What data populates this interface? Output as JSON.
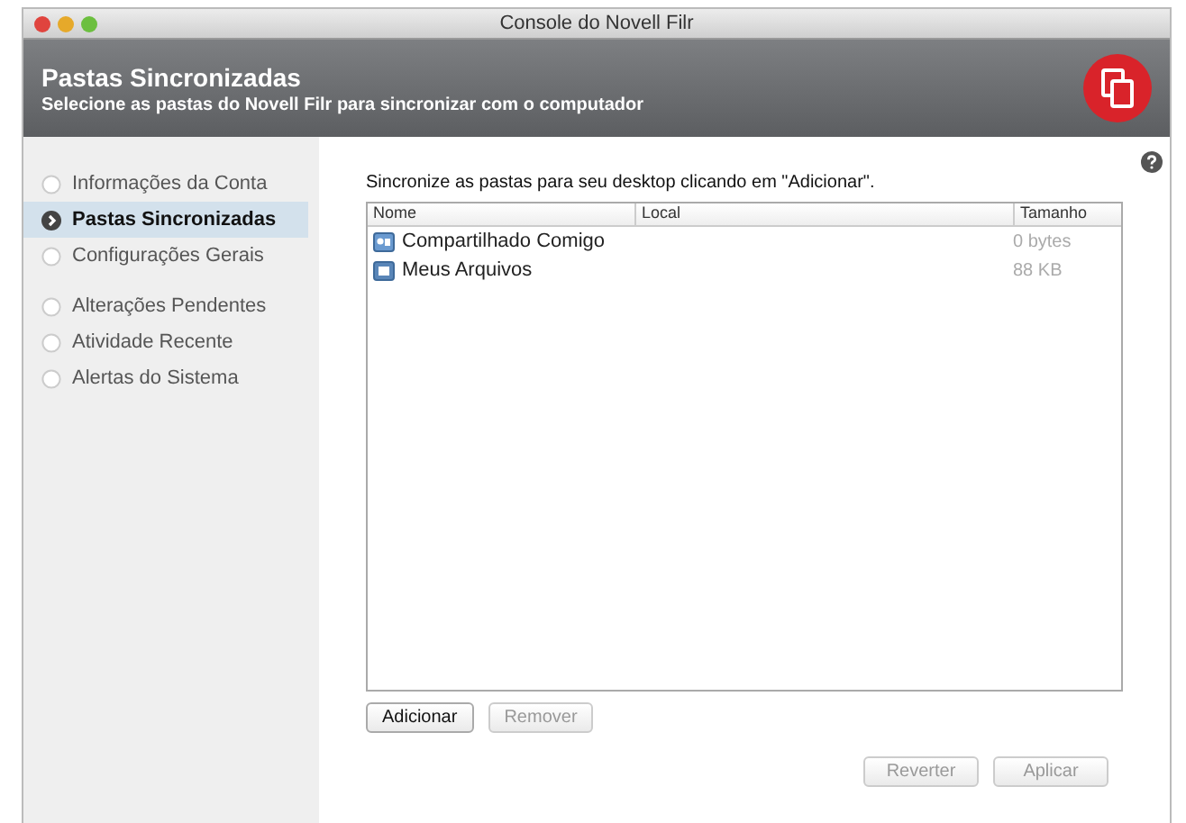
{
  "window": {
    "title": "Console do Novell Filr"
  },
  "header": {
    "title": "Pastas Sincronizadas",
    "subtitle": "Selecione as pastas do Novell Filr para sincronizar com o computador"
  },
  "sidebar": {
    "groups": [
      {
        "items": [
          {
            "label": "Informações da Conta",
            "selected": false
          },
          {
            "label": "Pastas Sincronizadas",
            "selected": true
          },
          {
            "label": "Configurações Gerais",
            "selected": false
          }
        ]
      },
      {
        "items": [
          {
            "label": "Alterações Pendentes",
            "selected": false
          },
          {
            "label": "Atividade Recente",
            "selected": false
          },
          {
            "label": "Alertas do Sistema",
            "selected": false
          }
        ]
      }
    ]
  },
  "instruction": "Sincronize as pastas para seu desktop clicando em \"Adicionar\".",
  "table": {
    "columns": [
      "Nome",
      "Local",
      "Tamanho"
    ],
    "rows": [
      {
        "kind": "shared",
        "name": "Compartilhado Comigo",
        "size": "0 bytes"
      },
      {
        "kind": "personal",
        "name": "Meus Arquivos",
        "size": "88 KB"
      }
    ]
  },
  "list_buttons": [
    {
      "label": "Adicionar",
      "disabled": false
    },
    {
      "label": "Remover",
      "disabled": true
    }
  ],
  "footer_buttons": [
    {
      "label": "Reverter",
      "disabled": true
    },
    {
      "label": "Aplicar",
      "disabled": true
    }
  ]
}
